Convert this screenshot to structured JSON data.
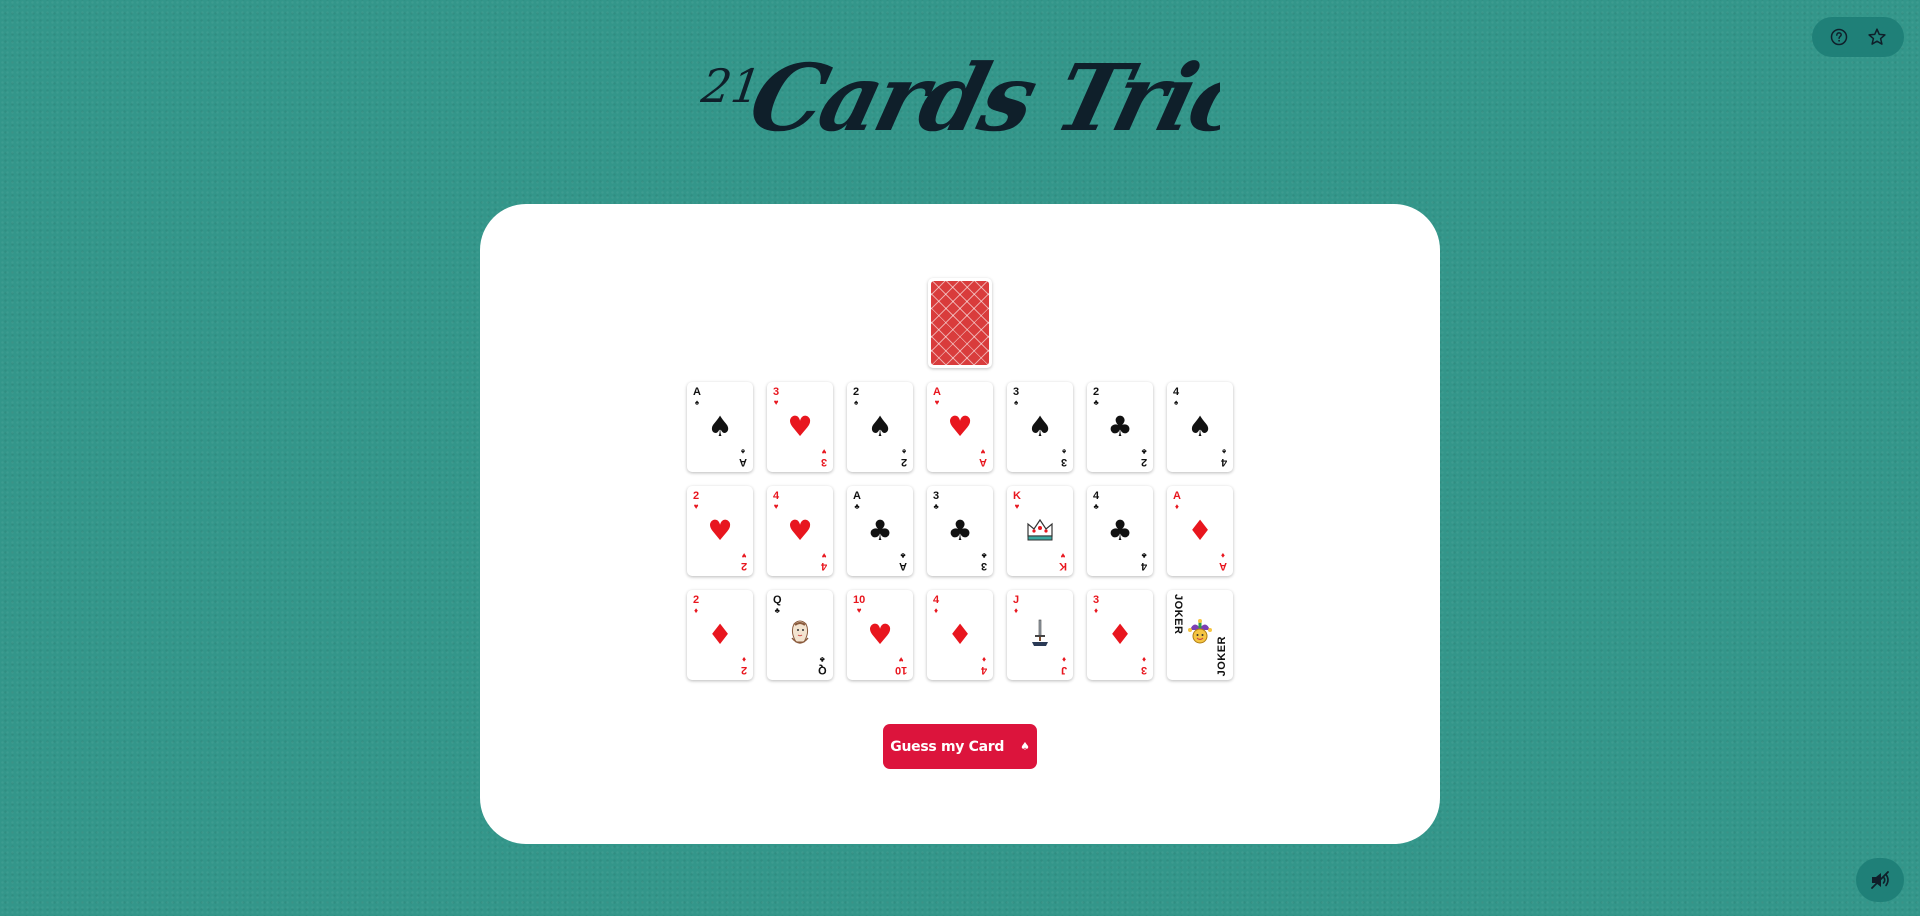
{
  "title": {
    "number": "21",
    "text": "Cards Trick!"
  },
  "top_actions": {
    "help_icon": "question-circle-icon",
    "favorite_icon": "star-icon"
  },
  "deck": {
    "back_color": "#d93c3c"
  },
  "cards": [
    [
      {
        "rank": "A",
        "suit": "♠",
        "color": "black"
      },
      {
        "rank": "3",
        "suit": "♥",
        "color": "red"
      },
      {
        "rank": "2",
        "suit": "♠",
        "color": "black"
      },
      {
        "rank": "A",
        "suit": "♥",
        "color": "red"
      },
      {
        "rank": "3",
        "suit": "♠",
        "color": "black"
      },
      {
        "rank": "2",
        "suit": "♣",
        "color": "black"
      },
      {
        "rank": "4",
        "suit": "♠",
        "color": "black"
      }
    ],
    [
      {
        "rank": "2",
        "suit": "♥",
        "color": "red"
      },
      {
        "rank": "4",
        "suit": "♥",
        "color": "red"
      },
      {
        "rank": "A",
        "suit": "♣",
        "color": "black"
      },
      {
        "rank": "3",
        "suit": "♣",
        "color": "black"
      },
      {
        "rank": "K",
        "suit": "♥",
        "color": "red",
        "face": "crown"
      },
      {
        "rank": "4",
        "suit": "♣",
        "color": "black"
      },
      {
        "rank": "A",
        "suit": "♦",
        "color": "red"
      }
    ],
    [
      {
        "rank": "2",
        "suit": "♦",
        "color": "red"
      },
      {
        "rank": "Q",
        "suit": "♣",
        "color": "black",
        "face": "queen"
      },
      {
        "rank": "10",
        "suit": "♥",
        "color": "red"
      },
      {
        "rank": "4",
        "suit": "♦",
        "color": "red"
      },
      {
        "rank": "J",
        "suit": "♦",
        "color": "red",
        "face": "sword"
      },
      {
        "rank": "3",
        "suit": "♦",
        "color": "red"
      },
      {
        "rank": "JOKER",
        "suit": "",
        "color": "black",
        "face": "jester"
      }
    ]
  ],
  "guess_button": {
    "label": "Guess my Card",
    "icon": "♠"
  },
  "sound_button": {
    "icon": "speaker-muted-icon"
  },
  "colors": {
    "background": "#33968a",
    "accent": "#dc143c",
    "panel": "#ffffff",
    "dark": "#0f1f2a"
  }
}
